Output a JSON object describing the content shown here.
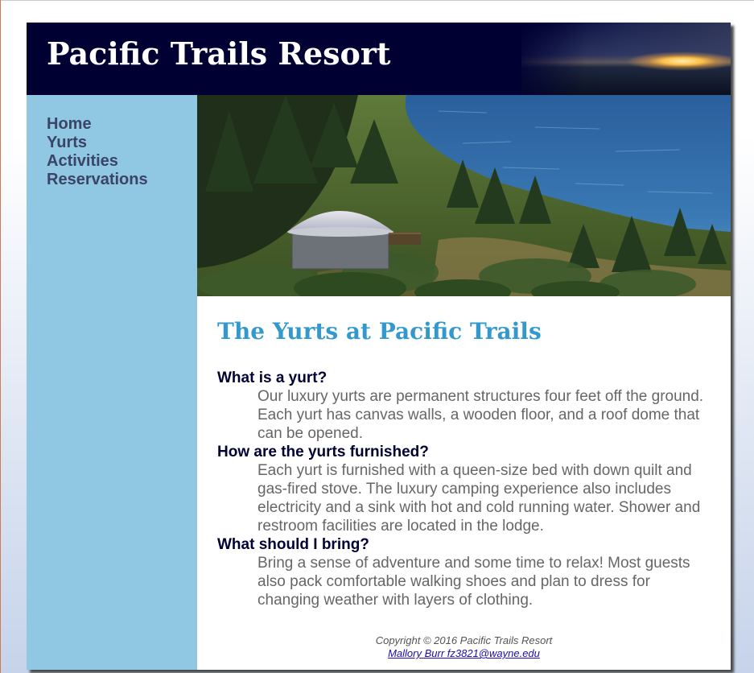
{
  "header": {
    "title": "Pacific Trails Resort"
  },
  "nav": {
    "items": [
      {
        "label": "Home"
      },
      {
        "label": "Yurts"
      },
      {
        "label": "Activities"
      },
      {
        "label": "Reservations"
      }
    ]
  },
  "main": {
    "heading": "The Yurts at Pacific Trails",
    "faq": [
      {
        "question": "What is a yurt?",
        "answer": "Our luxury yurts are permanent structures four feet off the ground. Each yurt has canvas walls, a wooden floor, and a roof dome that can be opened."
      },
      {
        "question": "How are the yurts furnished?",
        "answer": "Each yurt is furnished with a queen-size bed with down quilt and gas-fired stove. The luxury camping experience also includes electricity and a sink with hot and cold running water. Shower and restroom facilities are located in the lodge."
      },
      {
        "question": "What should I bring?",
        "answer": "Bring a sense of adventure and some time to relax! Most guests also pack comfortable walking shoes and plan to dress for changing weather with layers of clothing."
      }
    ]
  },
  "footer": {
    "copyright": "Copyright © 2016 Pacific Trails Resort",
    "contact_link": "Mallory Burr fz3821@wayne.edu"
  },
  "colors": {
    "page_background": "#ffffff",
    "header_background": "#000033",
    "nav_background": "#90c7e3",
    "nav_text": "#3a4466",
    "heading": "#3399cc",
    "question": "#000033",
    "answer": "#666666",
    "content_background": "#ffffff"
  },
  "icons": {
    "hero": "yurt-coastal-photo",
    "banner": "sunset-over-ocean"
  }
}
